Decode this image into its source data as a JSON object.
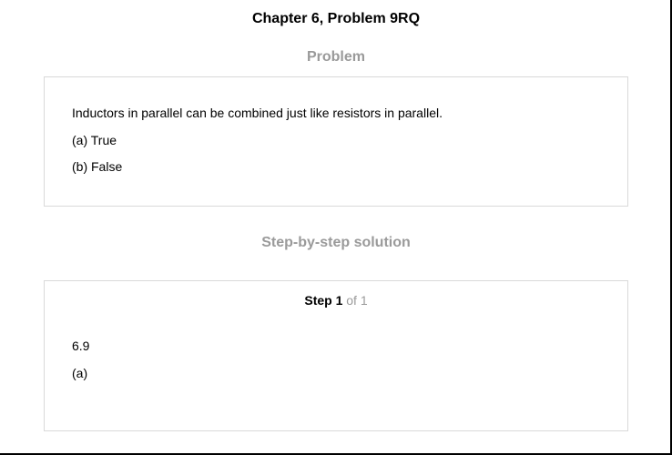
{
  "header": {
    "title": "Chapter 6, Problem 9RQ"
  },
  "problem": {
    "heading": "Problem",
    "text": "Inductors in parallel can be combined just like resistors in parallel.",
    "options": [
      "(a) True",
      "(b) False"
    ]
  },
  "solution": {
    "heading": "Step-by-step solution",
    "step_label": "Step 1",
    "step_of": "of 1",
    "lines": [
      "6.9",
      "(a)"
    ]
  }
}
